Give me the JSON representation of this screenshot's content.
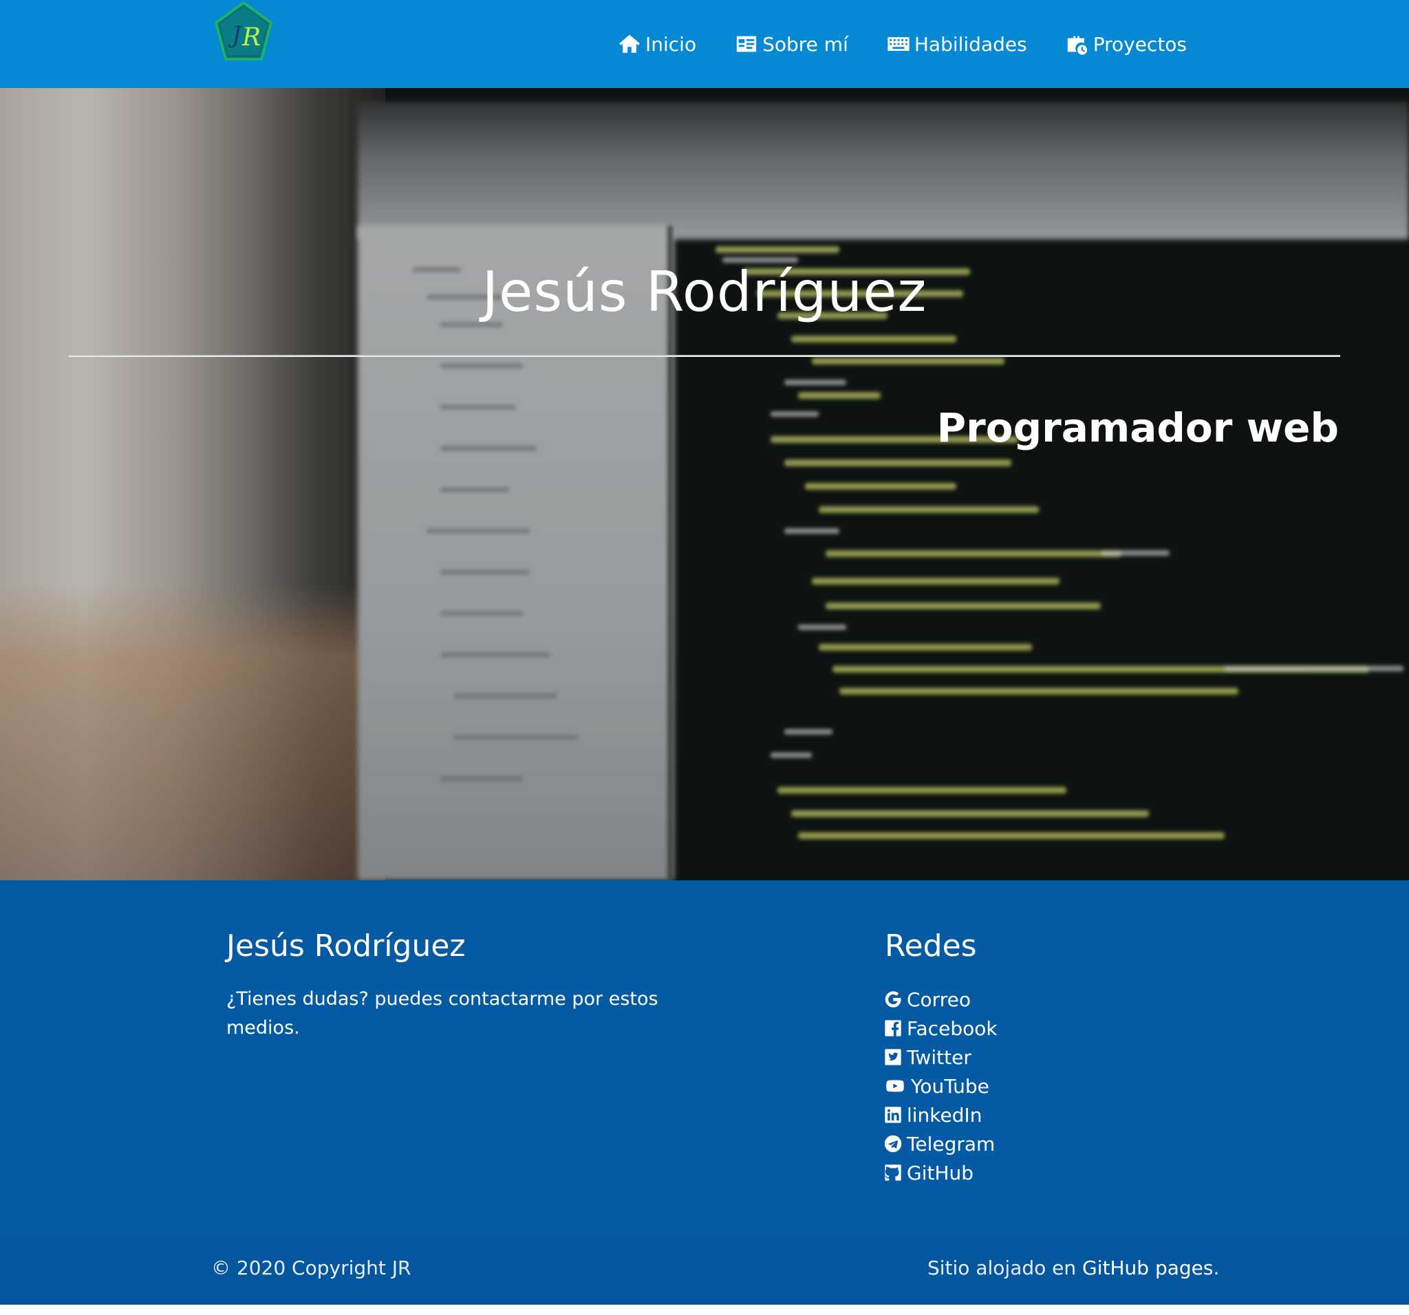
{
  "nav": {
    "logo_text": "JR",
    "items": [
      {
        "label": "Inicio",
        "icon": "home-icon"
      },
      {
        "label": "Sobre mí",
        "icon": "id-card-icon"
      },
      {
        "label": "Habilidades",
        "icon": "keyboard-icon"
      },
      {
        "label": "Proyectos",
        "icon": "briefcase-clock-icon"
      }
    ]
  },
  "hero": {
    "title": "Jesús Rodríguez",
    "subtitle": "Programador web"
  },
  "footer": {
    "about_title": "Jesús Rodríguez",
    "about_text": "¿Tienes dudas? puedes contactarme por estos medios.",
    "social_title": "Redes",
    "social_links": [
      {
        "label": "Correo",
        "icon": "google-icon"
      },
      {
        "label": "Facebook",
        "icon": "facebook-icon"
      },
      {
        "label": "Twitter",
        "icon": "twitter-icon"
      },
      {
        "label": "YouTube",
        "icon": "youtube-icon"
      },
      {
        "label": "linkedIn",
        "icon": "linkedin-icon"
      },
      {
        "label": "Telegram",
        "icon": "telegram-icon"
      },
      {
        "label": "GitHub",
        "icon": "github-icon"
      }
    ],
    "copyright": "© 2020 Copyright JR",
    "hosted_prefix": "Sitio alojado en",
    "hosted_link": "GitHub pages",
    "hosted_suffix": "."
  },
  "colors": {
    "navbar": "#0589d5",
    "footer": "#055aa4",
    "logo_green": "#1e9e5a",
    "logo_lime": "#b8e24a"
  }
}
